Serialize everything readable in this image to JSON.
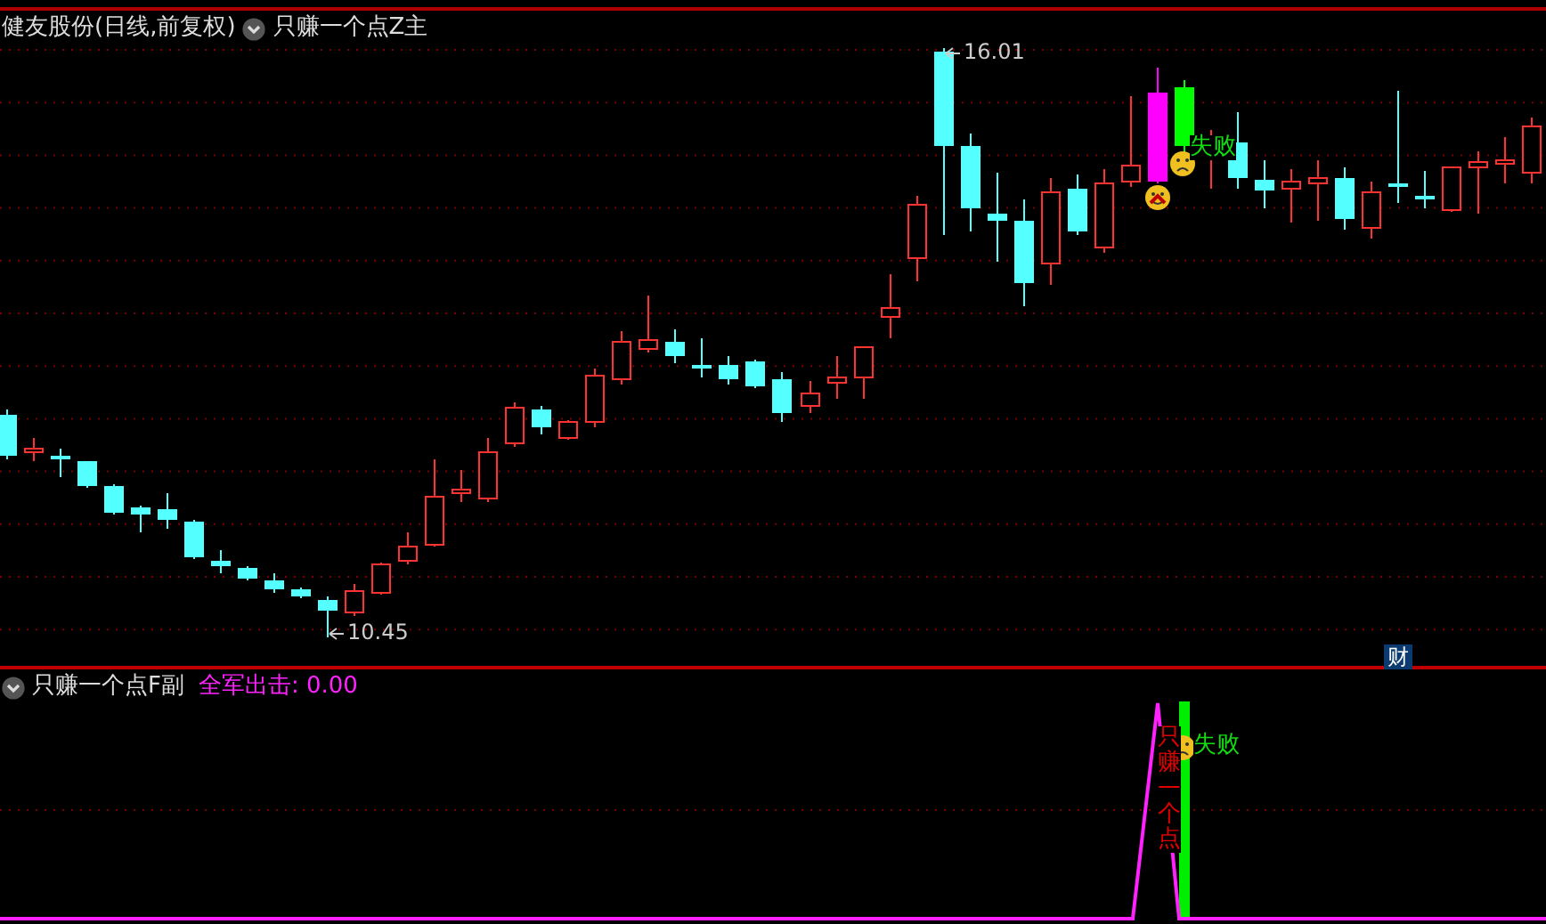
{
  "main_panel": {
    "title": "健友股份(日线,前复权)",
    "indicator": "只赚一个点Z主",
    "price_labels": [
      {
        "kind": "high",
        "text": "16.01"
      },
      {
        "kind": "low",
        "text": "10.45"
      }
    ],
    "signals": [
      {
        "kind": "fail",
        "text": "失败"
      }
    ],
    "badge": "财"
  },
  "sub_panel": {
    "indicator": "只赚一个点F副",
    "readout": "全军出击: 0.00",
    "signals": [
      {
        "kind": "fail",
        "text": "失败"
      }
    ],
    "vertical_text": "只赚一个点"
  }
}
